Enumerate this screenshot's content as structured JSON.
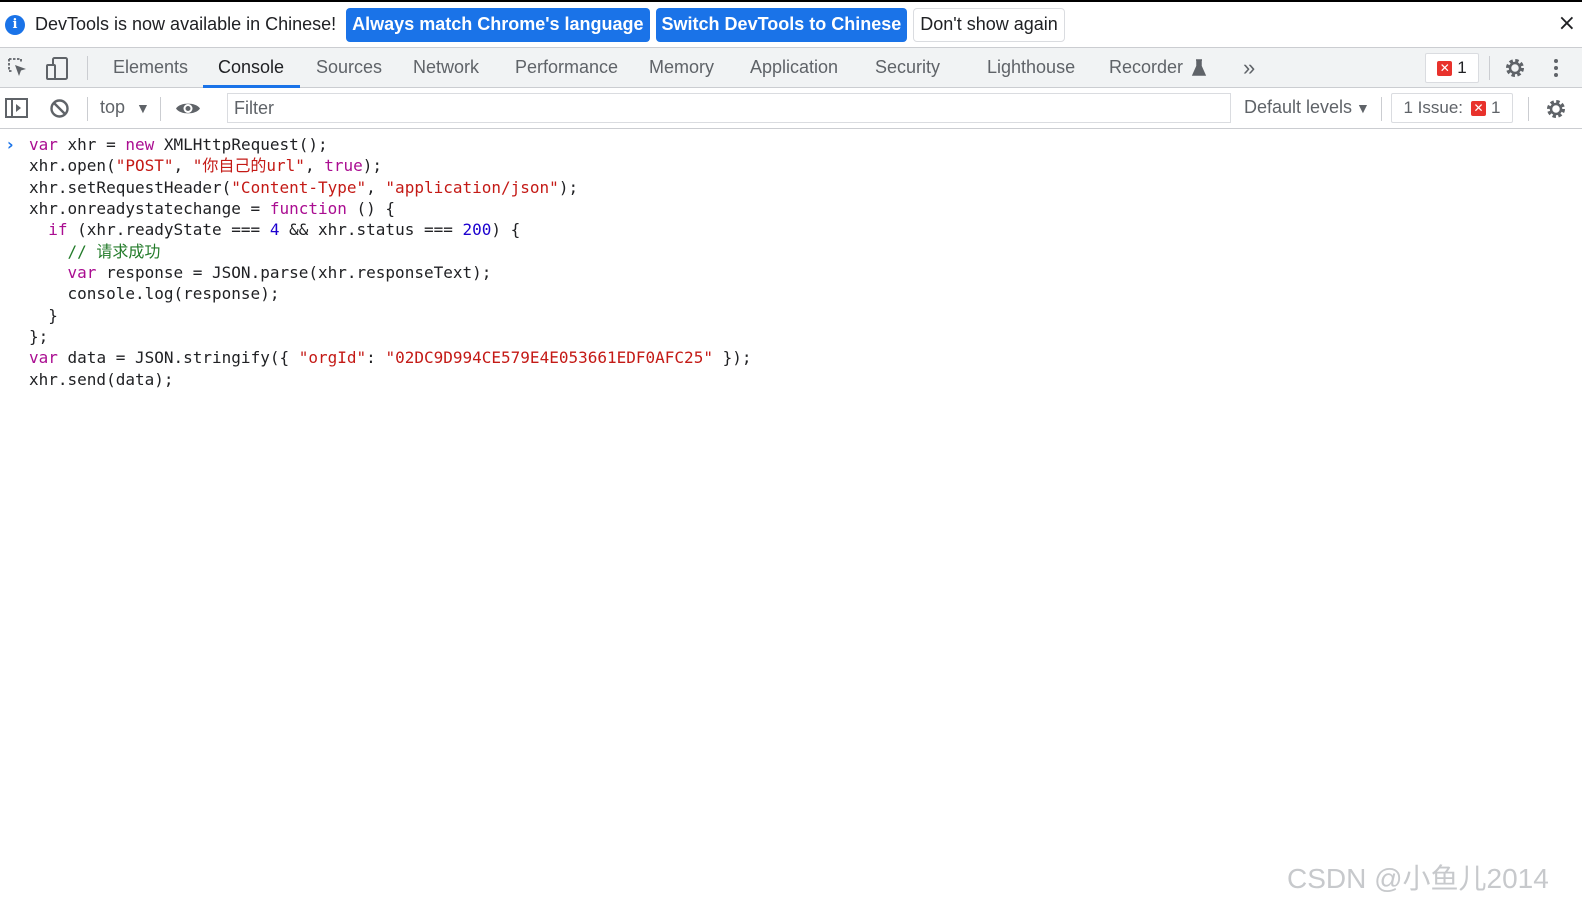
{
  "infobar": {
    "message": "DevTools is now available in Chinese!",
    "btn_match": "Always match Chrome's language",
    "btn_switch": "Switch DevTools to Chinese",
    "btn_dismiss": "Don't show again",
    "close_glyph": "×"
  },
  "tabs": [
    {
      "label": "Elements"
    },
    {
      "label": "Console"
    },
    {
      "label": "Sources"
    },
    {
      "label": "Network"
    },
    {
      "label": "Performance"
    },
    {
      "label": "Memory"
    },
    {
      "label": "Application"
    },
    {
      "label": "Security"
    },
    {
      "label": "Lighthouse"
    },
    {
      "label": "Recorder"
    }
  ],
  "active_tab": "Console",
  "toolbar": {
    "more_tabs_glyph": "»",
    "error_count": "1"
  },
  "console_toolbar": {
    "context": "top",
    "filter_placeholder": "Filter",
    "levels": "Default levels",
    "issues_label": "1 Issue:",
    "issues_count": "1"
  },
  "console": {
    "prompt": "›",
    "code": [
      "var xhr = new XMLHttpRequest();",
      "xhr.open(\"POST\", \"你自己的url\", true);",
      "xhr.setRequestHeader(\"Content-Type\", \"application/json\");",
      "xhr.onreadystatechange = function () {",
      "  if (xhr.readyState === 4 && xhr.status === 200) {",
      "    // 请求成功",
      "    var response = JSON.parse(xhr.responseText);",
      "    console.log(response);",
      "  }",
      "};",
      "var data = JSON.stringify({ \"orgId\": \"02DC9D994CE579E4E053661EDF0AFC25\" });",
      "xhr.send(data);"
    ]
  },
  "watermark": "CSDN @小鱼儿2014",
  "colors": {
    "accent": "#1a73e8",
    "error": "#e8322c",
    "keyword": "#aa0d91",
    "string": "#c41a16",
    "number": "#1c00cf",
    "comment": "#237b2a"
  },
  "icons": [
    "info-icon",
    "inspect-element-icon",
    "device-toggle-icon",
    "flask-icon",
    "more-tabs-icon",
    "settings-icon",
    "kebab-menu-icon",
    "sidebar-toggle-icon",
    "clear-console-icon",
    "eye-icon",
    "caret-down-icon",
    "error-icon",
    "close-icon"
  ]
}
